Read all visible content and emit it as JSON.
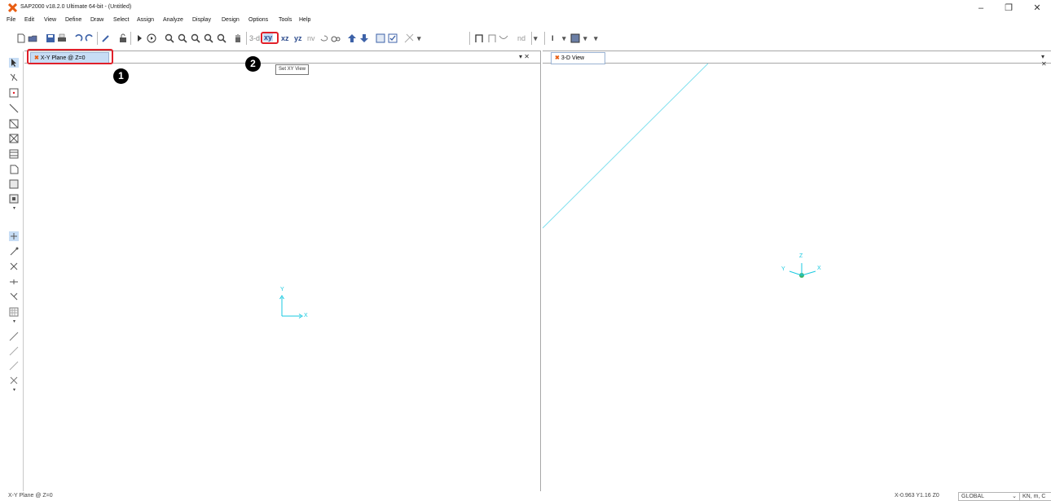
{
  "window": {
    "title": "SAP2000 v18.2.0 Ultimate 64-bit - (Untitled)",
    "controls": [
      "–",
      "❐",
      "✕"
    ]
  },
  "menu": [
    "File",
    "Edit",
    "View",
    "Define",
    "Draw",
    "Select",
    "Assign",
    "Analyze",
    "Display",
    "Design",
    "Options",
    "Tools",
    "Help"
  ],
  "toolbar": {
    "view_buttons": [
      "3-d",
      "xy",
      "xz",
      "yz",
      "nv"
    ],
    "nd_label": "nd",
    "tooltip": "Set XY View"
  },
  "left_pane": {
    "tab_label": "X-Y Plane @ Z=0",
    "axis_x": "X",
    "axis_y": "Y",
    "pane_controls": "▾ ✕"
  },
  "right_pane": {
    "tab_label": "3-D View",
    "axis_x": "X",
    "axis_y": "Y",
    "axis_z": "Z",
    "pane_controls": "▾ ✕"
  },
  "annotations": {
    "badge1": "1",
    "badge2": "2"
  },
  "status": {
    "left": "X-Y Plane @ Z=0",
    "coords": "X-0.963  Y1.16  Z0",
    "coord_system": "GLOBAL",
    "units": "KN, m, C"
  },
  "colors": {
    "highlight": "#e0202a",
    "axis": "#19c9e0",
    "selected_tab": "#c7ddf5"
  }
}
